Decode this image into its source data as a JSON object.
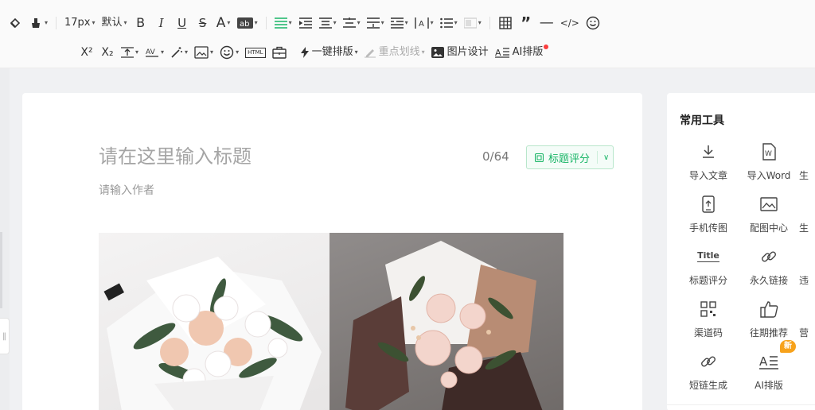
{
  "toolbar": {
    "font_size": "17px",
    "font_family": "默认",
    "superscript": "X²",
    "subscript": "X₂",
    "one_click_layout": "一键排版",
    "highlight_line": "重点划线",
    "image_design": "图片设计",
    "ai_layout": "AI排版",
    "html_label": "HTML",
    "accent_color": "#18b566",
    "icons_row1": [
      "format-painter-icon",
      "clear-format-icon",
      "bold-icon",
      "italic-icon",
      "underline-icon",
      "strikethrough-icon",
      "font-color-icon",
      "highlight-color-icon",
      "align-left-icon",
      "indent-icon",
      "outdent-icon",
      "line-height-icon",
      "paragraph-spacing-icon",
      "first-line-indent-icon",
      "letter-spacing-icon",
      "list-icon",
      "background-icon",
      "table-icon",
      "quote-icon",
      "divider-icon",
      "code-icon",
      "emoji-icon"
    ],
    "icons_row2": [
      "superscript-icon",
      "subscript-icon",
      "vertical-align-icon",
      "char-spacing-icon",
      "magic-wand-icon",
      "image-style-icon",
      "emoji-icon",
      "html-icon",
      "toolbox-icon",
      "lightning-icon",
      "pen-icon",
      "image-icon",
      "ai-layout-icon"
    ]
  },
  "editor": {
    "title_placeholder": "请在这里输入标题",
    "title_counter": "0/64",
    "score_button": "标题评分",
    "author_placeholder": "请输入作者"
  },
  "tools_panel": {
    "title": "常用工具",
    "items": [
      {
        "label": "导入文章",
        "icon": "download-icon"
      },
      {
        "label": "导入Word",
        "icon": "word-icon"
      },
      {
        "label": "生",
        "icon": "cut-off-icon"
      },
      {
        "label": "手机传图",
        "icon": "phone-upload-icon"
      },
      {
        "label": "配图中心",
        "icon": "image-center-icon"
      },
      {
        "label": "生",
        "icon": "cut-off-icon"
      },
      {
        "label": "标题评分",
        "icon": "title-score-icon",
        "glyph": "Title"
      },
      {
        "label": "永久链接",
        "icon": "link-icon"
      },
      {
        "label": "违",
        "icon": "cut-off-icon"
      },
      {
        "label": "渠道码",
        "icon": "qr-code-icon"
      },
      {
        "label": "往期推荐",
        "icon": "thumbs-up-icon"
      },
      {
        "label": "营",
        "icon": "cut-off-icon"
      },
      {
        "label": "短链生成",
        "icon": "short-link-icon"
      },
      {
        "label": "AI排版",
        "icon": "ai-layout-icon",
        "badge": "新"
      }
    ]
  }
}
